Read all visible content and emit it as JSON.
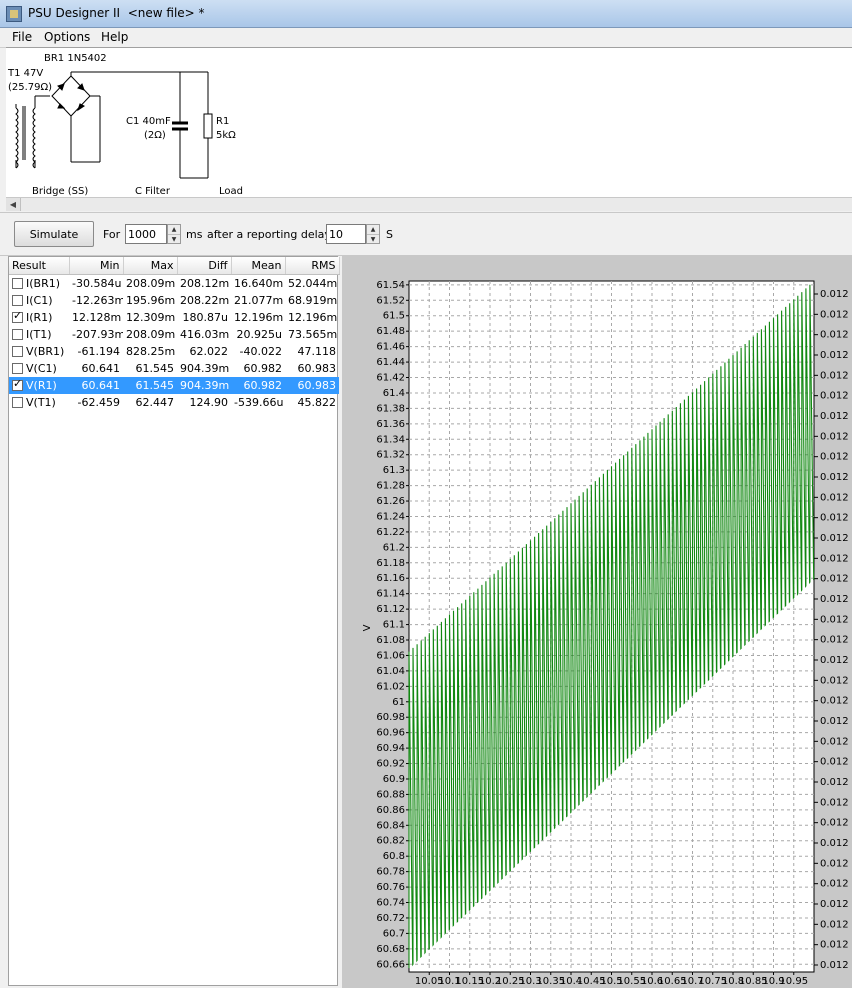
{
  "window": {
    "title": "PSU Designer II  <new file> *"
  },
  "menu": [
    "File",
    "Options",
    "Help"
  ],
  "schematic": {
    "bridge_name": "BR1 1N5402",
    "transformer_name": "T1 47V",
    "transformer_resistance": "(25.79Ω)",
    "capacitor_name": "C1 40mF",
    "capacitor_esr": "(2Ω)",
    "load_name": "R1",
    "load_value": "5kΩ",
    "label_bridge": "Bridge (SS)",
    "label_filter": "C Filter",
    "label_load": "Load"
  },
  "toolbar": {
    "simulate_label": "Simulate",
    "for_label": "For",
    "duration_value": "1000",
    "ms_label": "ms",
    "delay_label": "after a reporting delay of",
    "delay_value": "10",
    "s_label": "S"
  },
  "results": {
    "headers": [
      "Result",
      "Min",
      "Max",
      "Diff",
      "Mean",
      "RMS"
    ],
    "rows": [
      {
        "name": "I(BR1)",
        "checked": false,
        "selected": false,
        "min": "-30.584u",
        "max": "208.09m",
        "diff": "208.12m",
        "mean": "16.640m",
        "rms": "52.044m"
      },
      {
        "name": "I(C1)",
        "checked": false,
        "selected": false,
        "min": "-12.263m",
        "max": "195.96m",
        "diff": "208.22m",
        "mean": "21.077m",
        "rms": "68.919m"
      },
      {
        "name": "I(R1)",
        "checked": true,
        "selected": false,
        "min": "12.128m",
        "max": "12.309m",
        "diff": "180.87u",
        "mean": "12.196m",
        "rms": "12.196m"
      },
      {
        "name": "I(T1)",
        "checked": false,
        "selected": false,
        "min": "-207.93m",
        "max": "208.09m",
        "diff": "416.03m",
        "mean": "20.925u",
        "rms": "73.565m"
      },
      {
        "name": "V(BR1)",
        "checked": false,
        "selected": false,
        "min": "-61.194",
        "max": "828.25m",
        "diff": "62.022",
        "mean": "-40.022",
        "rms": "47.118"
      },
      {
        "name": "V(C1)",
        "checked": false,
        "selected": false,
        "min": "60.641",
        "max": "61.545",
        "diff": "904.39m",
        "mean": "60.982",
        "rms": "60.983"
      },
      {
        "name": "V(R1)",
        "checked": true,
        "selected": true,
        "min": "60.641",
        "max": "61.545",
        "diff": "904.39m",
        "mean": "60.982",
        "rms": "60.983"
      },
      {
        "name": "V(T1)",
        "checked": false,
        "selected": false,
        "min": "-62.459",
        "max": "62.447",
        "diff": "124.90",
        "mean": "-539.66u",
        "rms": "45.822"
      }
    ]
  },
  "chart_data": {
    "type": "line",
    "ylabel": "V",
    "ylim": [
      60.65,
      61.545
    ],
    "xlim": [
      10.0,
      11.0
    ],
    "y_ticks": [
      "61.54",
      "61.52",
      "61.5",
      "61.48",
      "61.46",
      "61.44",
      "61.42",
      "61.4",
      "61.38",
      "61.36",
      "61.34",
      "61.32",
      "61.3",
      "61.28",
      "61.26",
      "61.24",
      "61.22",
      "61.2",
      "61.18",
      "61.16",
      "61.14",
      "61.12",
      "61.1",
      "61.08",
      "61.06",
      "61.04",
      "61.02",
      "61",
      "60.98",
      "60.96",
      "60.94",
      "60.92",
      "60.9",
      "60.88",
      "60.86",
      "60.84",
      "60.82",
      "60.8",
      "60.78",
      "60.76",
      "60.74",
      "60.72",
      "60.7",
      "60.68",
      "60.66"
    ],
    "y2_ticks": [
      "0.012",
      "0.012",
      "0.012",
      "0.012",
      "0.012",
      "0.012",
      "0.012",
      "0.012",
      "0.012",
      "0.012",
      "0.012",
      "0.012",
      "0.012",
      "0.012",
      "0.012",
      "0.012",
      "0.012",
      "0.012",
      "0.012",
      "0.012",
      "0.012",
      "0.012",
      "0.012",
      "0.012",
      "0.012",
      "0.012",
      "0.012",
      "0.012",
      "0.012",
      "0.012",
      "0.012",
      "0.012",
      "0.012",
      "0.012"
    ],
    "x_ticks": [
      "10.05",
      "10.1",
      "10.15",
      "10.2",
      "10.25",
      "10.3",
      "10.35",
      "10.4",
      "10.45",
      "10.5",
      "10.55",
      "10.6",
      "10.65",
      "10.7",
      "10.75",
      "10.8",
      "10.85",
      "10.9",
      "10.95"
    ],
    "series": [
      {
        "color": "#118811",
        "ripple_cycles": 100,
        "trough_start": 60.655,
        "trough_end": 61.16,
        "peak_start": 61.065,
        "peak_end": 61.545
      }
    ],
    "grid": true
  }
}
